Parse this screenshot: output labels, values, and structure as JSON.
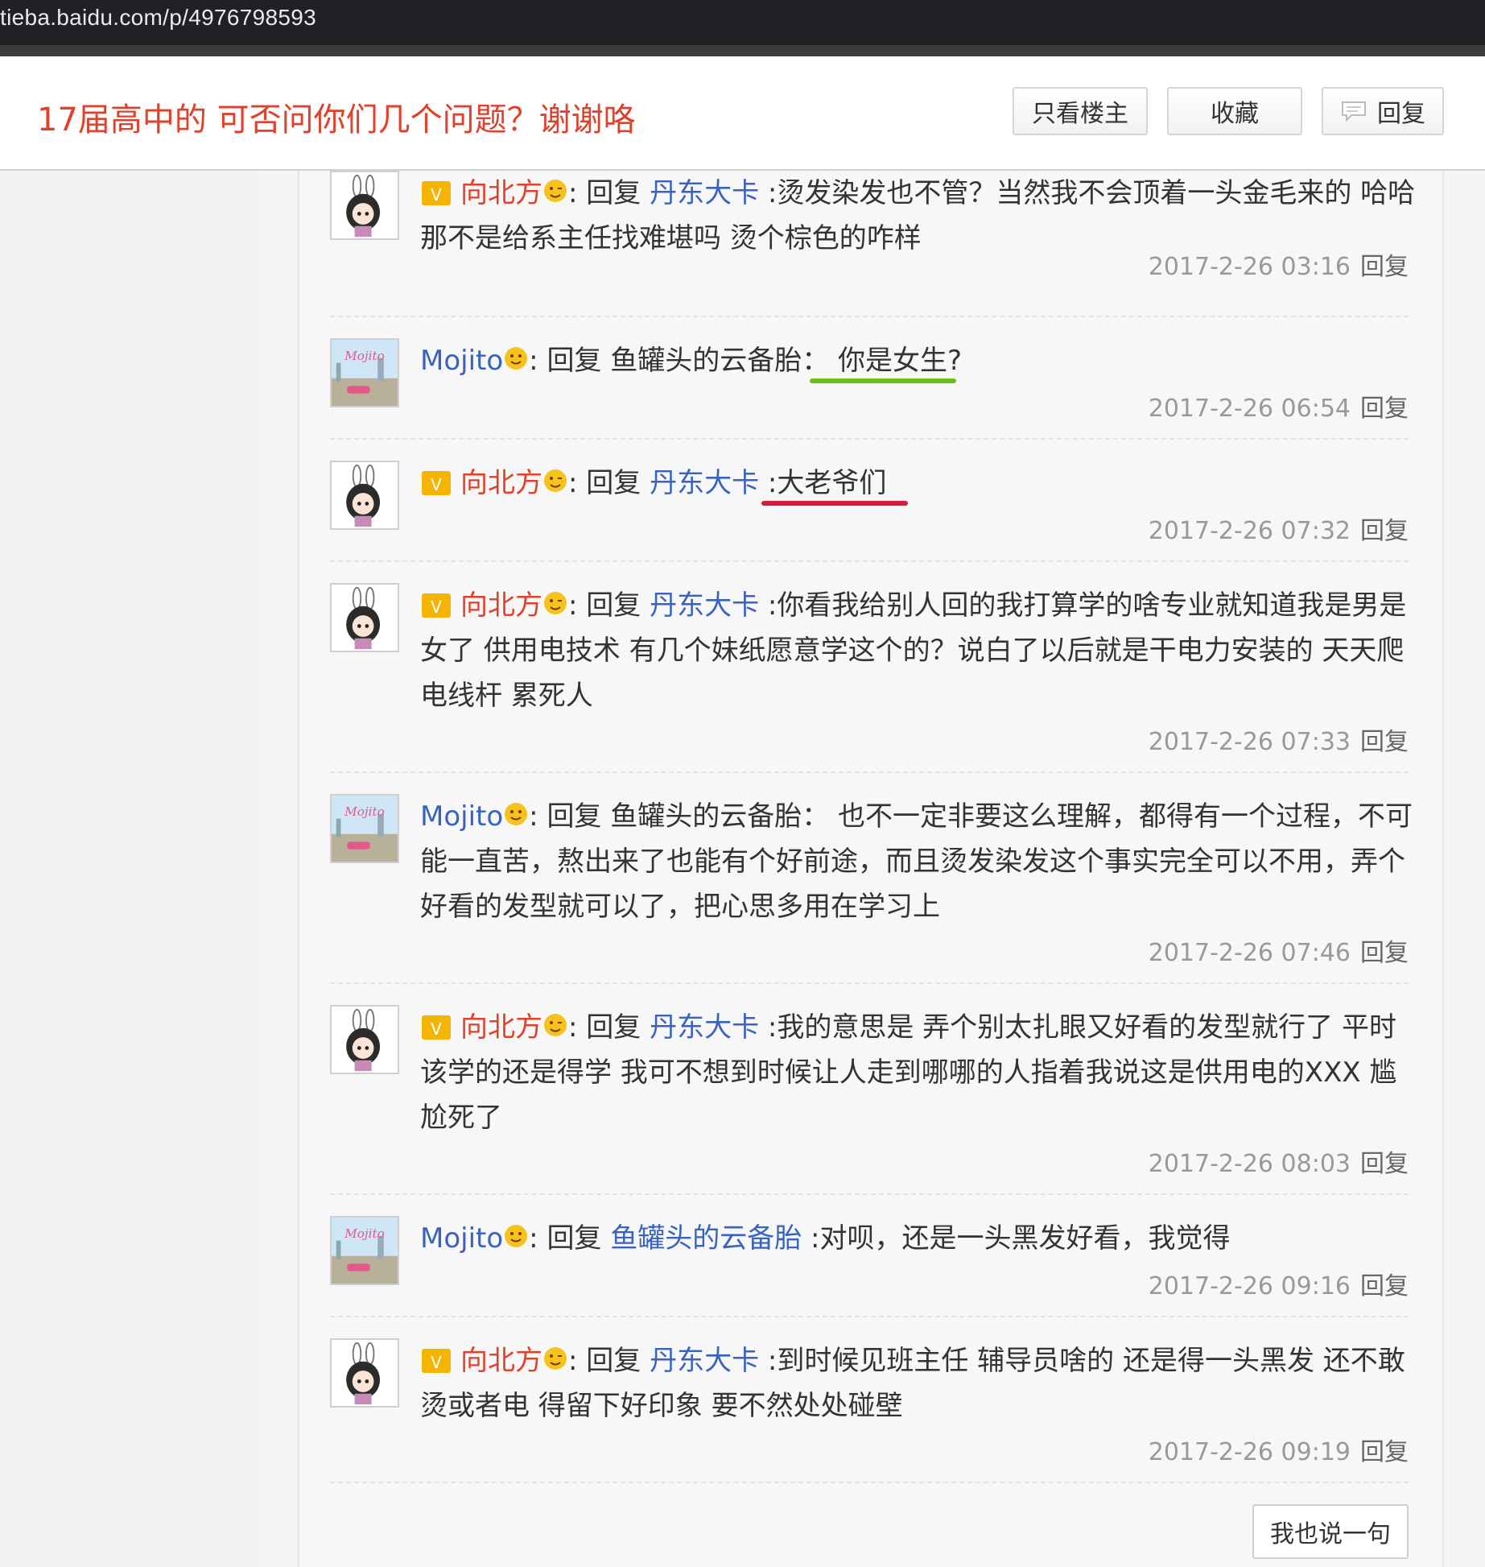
{
  "browser": {
    "url": "tieba.baidu.com/p/4976798593"
  },
  "thread": {
    "title": "17届高中的 可否问你们几个问题？谢谢咯",
    "only_op_label": "只看楼主",
    "favorite_label": "收藏",
    "reply_label": "回复"
  },
  "replies": [
    {
      "user": "向北方",
      "reply_word": "回复",
      "target": "丹东大卡",
      "text": " :烫发染发也不管？当然我不会顶着一头金毛来的 哈哈 那不是给系主任找难堪吗 烫个棕色的咋样",
      "time": "2017-2-26 03:16",
      "action": "回复"
    },
    {
      "user": "Mojito",
      "reply_word": "回复",
      "target": "鱼罐头的云备胎",
      "text": "：  你是女生?",
      "time": "2017-2-26 06:54",
      "action": "回复"
    },
    {
      "user": "向北方",
      "reply_word": "回复",
      "target": "丹东大卡",
      "text": " :大老爷们",
      "time": "2017-2-26 07:32",
      "action": "回复"
    },
    {
      "user": "向北方",
      "reply_word": "回复",
      "target": "丹东大卡",
      "text": " :你看我给别人回的我打算学的啥专业就知道我是男是女了 供用电技术 有几个妹纸愿意学这个的？说白了以后就是干电力安装的 天天爬电线杆 累死人",
      "time": "2017-2-26 07:33",
      "action": "回复"
    },
    {
      "user": "Mojito",
      "reply_word": "回复",
      "target": "鱼罐头的云备胎",
      "text": "：  也不一定非要这么理解，都得有一个过程，不可能一直苦，熬出来了也能有个好前途，而且烫发染发这个事实完全可以不用，弄个好看的发型就可以了，把心思多用在学习上",
      "time": "2017-2-26 07:46",
      "action": "回复"
    },
    {
      "user": "向北方",
      "reply_word": "回复",
      "target": "丹东大卡",
      "text": " :我的意思是 弄个别太扎眼又好看的发型就行了 平时该学的还是得学 我可不想到时候让人走到哪哪的人指着我说这是供用电的XXX 尴尬死了",
      "time": "2017-2-26 08:03",
      "action": "回复"
    },
    {
      "user": "Mojito",
      "reply_word": "回复",
      "target": "鱼罐头的云备胎",
      "text": " :对呗，还是一头黑发好看，我觉得",
      "time": "2017-2-26 09:16",
      "action": "回复"
    },
    {
      "user": "向北方",
      "reply_word": "回复",
      "target": "丹东大卡",
      "text": " :到时候见班主任 辅导员啥的 还是得一头黑发 还不敢烫或者电 得留下好印象 要不然处处碰壁",
      "time": "2017-2-26 09:19",
      "action": "回复"
    }
  ],
  "footer": {
    "post_label": "我也说一句"
  },
  "colors": {
    "title": "#e1402a",
    "username_vip": "#e1402a",
    "link": "#3a63c0",
    "underline_green": "#6cbf1a",
    "underline_red": "#d81b3c"
  }
}
